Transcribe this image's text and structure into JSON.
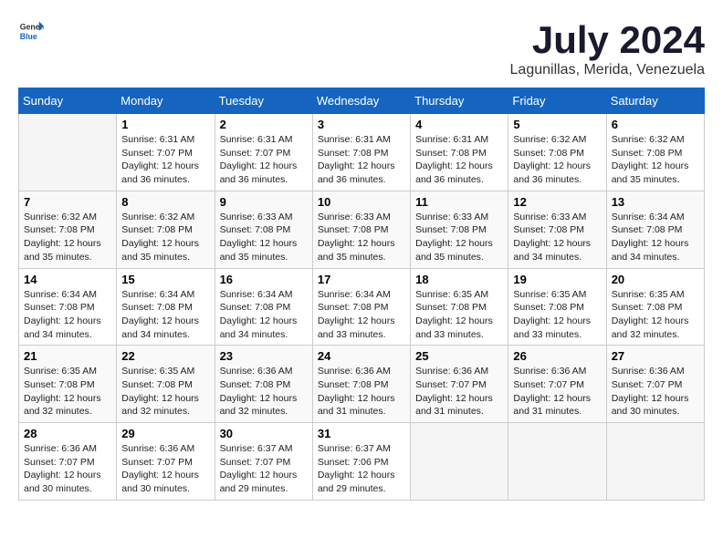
{
  "logo": {
    "general": "General",
    "blue": "Blue"
  },
  "title": "July 2024",
  "subtitle": "Lagunillas, Merida, Venezuela",
  "days_header": [
    "Sunday",
    "Monday",
    "Tuesday",
    "Wednesday",
    "Thursday",
    "Friday",
    "Saturday"
  ],
  "weeks": [
    [
      {
        "day": "",
        "info": ""
      },
      {
        "day": "1",
        "info": "Sunrise: 6:31 AM\nSunset: 7:07 PM\nDaylight: 12 hours\nand 36 minutes."
      },
      {
        "day": "2",
        "info": "Sunrise: 6:31 AM\nSunset: 7:07 PM\nDaylight: 12 hours\nand 36 minutes."
      },
      {
        "day": "3",
        "info": "Sunrise: 6:31 AM\nSunset: 7:08 PM\nDaylight: 12 hours\nand 36 minutes."
      },
      {
        "day": "4",
        "info": "Sunrise: 6:31 AM\nSunset: 7:08 PM\nDaylight: 12 hours\nand 36 minutes."
      },
      {
        "day": "5",
        "info": "Sunrise: 6:32 AM\nSunset: 7:08 PM\nDaylight: 12 hours\nand 36 minutes."
      },
      {
        "day": "6",
        "info": "Sunrise: 6:32 AM\nSunset: 7:08 PM\nDaylight: 12 hours\nand 35 minutes."
      }
    ],
    [
      {
        "day": "7",
        "info": "Sunrise: 6:32 AM\nSunset: 7:08 PM\nDaylight: 12 hours\nand 35 minutes."
      },
      {
        "day": "8",
        "info": "Sunrise: 6:32 AM\nSunset: 7:08 PM\nDaylight: 12 hours\nand 35 minutes."
      },
      {
        "day": "9",
        "info": "Sunrise: 6:33 AM\nSunset: 7:08 PM\nDaylight: 12 hours\nand 35 minutes."
      },
      {
        "day": "10",
        "info": "Sunrise: 6:33 AM\nSunset: 7:08 PM\nDaylight: 12 hours\nand 35 minutes."
      },
      {
        "day": "11",
        "info": "Sunrise: 6:33 AM\nSunset: 7:08 PM\nDaylight: 12 hours\nand 35 minutes."
      },
      {
        "day": "12",
        "info": "Sunrise: 6:33 AM\nSunset: 7:08 PM\nDaylight: 12 hours\nand 34 minutes."
      },
      {
        "day": "13",
        "info": "Sunrise: 6:34 AM\nSunset: 7:08 PM\nDaylight: 12 hours\nand 34 minutes."
      }
    ],
    [
      {
        "day": "14",
        "info": "Sunrise: 6:34 AM\nSunset: 7:08 PM\nDaylight: 12 hours\nand 34 minutes."
      },
      {
        "day": "15",
        "info": "Sunrise: 6:34 AM\nSunset: 7:08 PM\nDaylight: 12 hours\nand 34 minutes."
      },
      {
        "day": "16",
        "info": "Sunrise: 6:34 AM\nSunset: 7:08 PM\nDaylight: 12 hours\nand 34 minutes."
      },
      {
        "day": "17",
        "info": "Sunrise: 6:34 AM\nSunset: 7:08 PM\nDaylight: 12 hours\nand 33 minutes."
      },
      {
        "day": "18",
        "info": "Sunrise: 6:35 AM\nSunset: 7:08 PM\nDaylight: 12 hours\nand 33 minutes."
      },
      {
        "day": "19",
        "info": "Sunrise: 6:35 AM\nSunset: 7:08 PM\nDaylight: 12 hours\nand 33 minutes."
      },
      {
        "day": "20",
        "info": "Sunrise: 6:35 AM\nSunset: 7:08 PM\nDaylight: 12 hours\nand 32 minutes."
      }
    ],
    [
      {
        "day": "21",
        "info": "Sunrise: 6:35 AM\nSunset: 7:08 PM\nDaylight: 12 hours\nand 32 minutes."
      },
      {
        "day": "22",
        "info": "Sunrise: 6:35 AM\nSunset: 7:08 PM\nDaylight: 12 hours\nand 32 minutes."
      },
      {
        "day": "23",
        "info": "Sunrise: 6:36 AM\nSunset: 7:08 PM\nDaylight: 12 hours\nand 32 minutes."
      },
      {
        "day": "24",
        "info": "Sunrise: 6:36 AM\nSunset: 7:08 PM\nDaylight: 12 hours\nand 31 minutes."
      },
      {
        "day": "25",
        "info": "Sunrise: 6:36 AM\nSunset: 7:07 PM\nDaylight: 12 hours\nand 31 minutes."
      },
      {
        "day": "26",
        "info": "Sunrise: 6:36 AM\nSunset: 7:07 PM\nDaylight: 12 hours\nand 31 minutes."
      },
      {
        "day": "27",
        "info": "Sunrise: 6:36 AM\nSunset: 7:07 PM\nDaylight: 12 hours\nand 30 minutes."
      }
    ],
    [
      {
        "day": "28",
        "info": "Sunrise: 6:36 AM\nSunset: 7:07 PM\nDaylight: 12 hours\nand 30 minutes."
      },
      {
        "day": "29",
        "info": "Sunrise: 6:36 AM\nSunset: 7:07 PM\nDaylight: 12 hours\nand 30 minutes."
      },
      {
        "day": "30",
        "info": "Sunrise: 6:37 AM\nSunset: 7:07 PM\nDaylight: 12 hours\nand 29 minutes."
      },
      {
        "day": "31",
        "info": "Sunrise: 6:37 AM\nSunset: 7:06 PM\nDaylight: 12 hours\nand 29 minutes."
      },
      {
        "day": "",
        "info": ""
      },
      {
        "day": "",
        "info": ""
      },
      {
        "day": "",
        "info": ""
      }
    ]
  ]
}
